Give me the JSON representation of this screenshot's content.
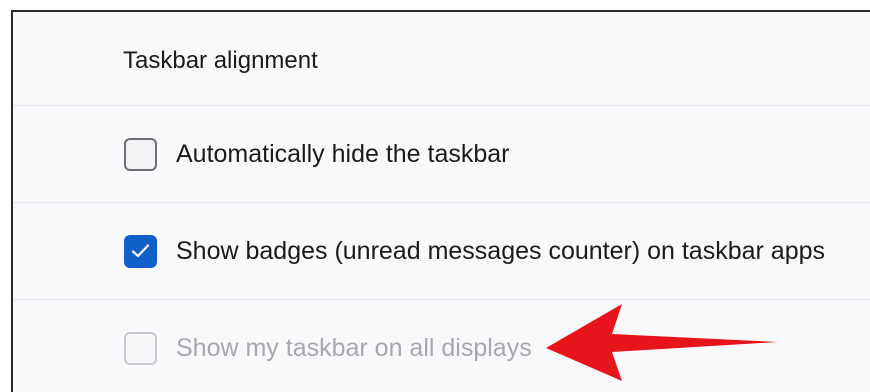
{
  "taskbar_settings": {
    "alignment_label": "Taskbar alignment",
    "options": [
      {
        "label": "Automatically hide the taskbar",
        "checked": false,
        "enabled": true
      },
      {
        "label": "Show badges (unread messages counter) on taskbar apps",
        "checked": true,
        "enabled": true
      },
      {
        "label": "Show my taskbar on all displays",
        "checked": false,
        "enabled": false
      }
    ]
  },
  "annotation": {
    "arrow_icon": "red-arrow-left-icon",
    "arrow_color": "#e8141c"
  },
  "colors": {
    "accent": "#1060c9",
    "background": "#f9f9fb",
    "divider": "#e4e7ef",
    "disabled_text": "#a8a8ac"
  }
}
